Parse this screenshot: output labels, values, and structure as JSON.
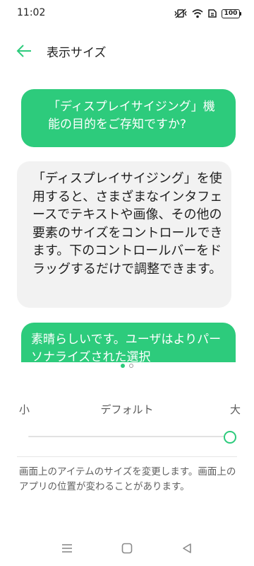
{
  "status_bar": {
    "time": "11:02",
    "battery": "100",
    "icons": [
      "mute-vibrate-icon",
      "wifi-icon",
      "sim-card-icon",
      "battery-icon"
    ]
  },
  "header": {
    "back_icon": "arrow-left-icon",
    "title": "表示サイズ"
  },
  "preview": {
    "question_1": "「ディスプレイサイジング」機能の目的をご存知ですか?",
    "answer_1": "「ディスプレイサイジング」を使用すると、さまざまなインタフェースでテキストや画像、その他の要素のサイズをコントロールできます。下のコントロールバーをドラッグするだけで調整できます。",
    "question_2": "素晴らしいです。ユーザはよりパーソナライズされた選択",
    "page_count": 2,
    "active_page": 1
  },
  "size_control": {
    "min_label": "小",
    "default_label": "デフォルト",
    "max_label": "大",
    "value_fraction": 1.0
  },
  "description": "画面上のアイテムのサイズを変更します。画面上のアプリの位置が変わることがあります。",
  "nav_bar": {
    "buttons": [
      "menu-icon",
      "home-icon",
      "back-triangle-icon"
    ]
  },
  "colors": {
    "accent": "#2dcb7c",
    "bubble_gray": "#f2f2f2"
  }
}
